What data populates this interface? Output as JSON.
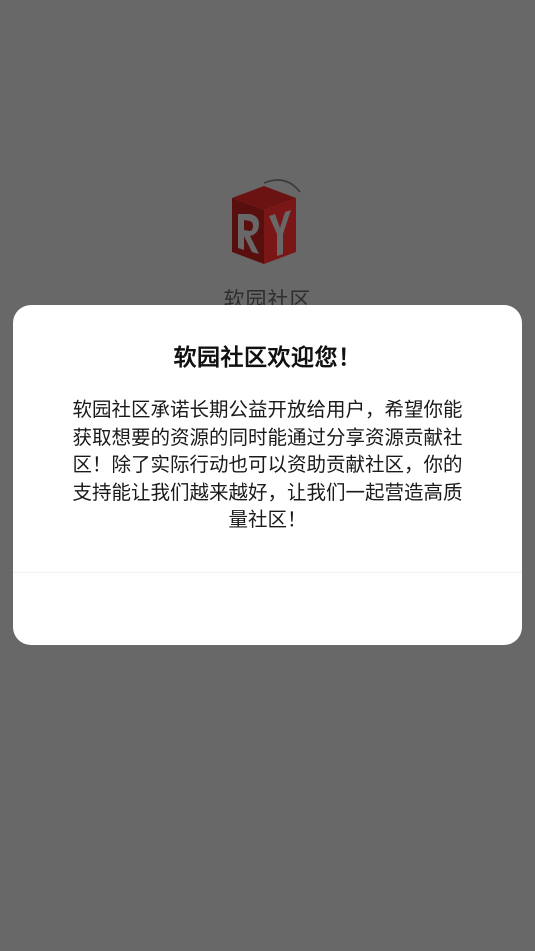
{
  "splash": {
    "app_name": "软园社区",
    "logo_text": "RY",
    "logo_icon": "ry-cube-logo-icon"
  },
  "dialog": {
    "title": "软园社区欢迎您！",
    "body": "软园社区承诺长期公益开放给用户，希望你能获取想要的资源的同时能通过分享资源贡献社区！除了实际行动也可以资助贡献社区，你的支持能让我们越来越好，让我们一起营造高质量社区！"
  },
  "colors": {
    "overlay_background": "#686868",
    "logo_red": "#6e1414",
    "dialog_background": "#ffffff"
  }
}
